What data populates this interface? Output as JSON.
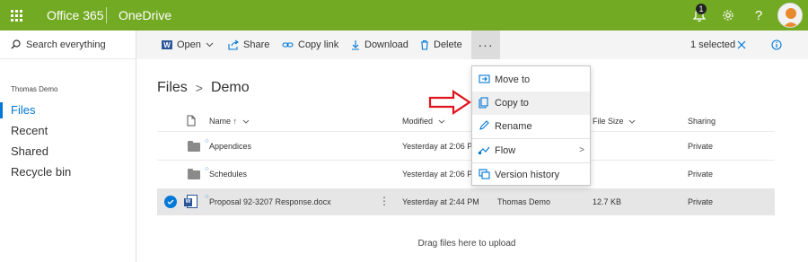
{
  "topbar": {
    "brand": "Office 365",
    "app_name": "OneDrive",
    "notification_count": "1",
    "help_label": "?",
    "accent_color": "#73aa23"
  },
  "sidebar": {
    "search_label": "Search everything",
    "user_name": "Thomas Demo",
    "items": [
      {
        "label": "Files",
        "active": true
      },
      {
        "label": "Recent",
        "active": false
      },
      {
        "label": "Shared",
        "active": false
      },
      {
        "label": "Recycle bin",
        "active": false
      }
    ]
  },
  "commandbar": {
    "open_label": "Open",
    "share_label": "Share",
    "copylink_label": "Copy link",
    "download_label": "Download",
    "delete_label": "Delete",
    "more_label": "···",
    "selected_label": "1 selected"
  },
  "breadcrumb": {
    "root": "Files",
    "separator": ">",
    "current": "Demo"
  },
  "list": {
    "columns": {
      "name": "Name ↑",
      "modified": "Modified",
      "file_size": "File Size",
      "sharing": "Sharing"
    },
    "rows": [
      {
        "name": "Appendices",
        "modified": "Yesterday at 2:06 PM",
        "modified_by": "",
        "size": "",
        "sharing": "Private",
        "selected": false,
        "type": "folder"
      },
      {
        "name": "Schedules",
        "modified": "Yesterday at 2:06 PM",
        "modified_by": "",
        "size": "",
        "sharing": "Private",
        "selected": false,
        "type": "folder"
      },
      {
        "name": "Proposal 92-3207 Response.docx",
        "modified": "Yesterday at 2:44 PM",
        "modified_by": "Thomas Demo",
        "size": "12.7 KB",
        "sharing": "Private",
        "selected": true,
        "type": "docx"
      }
    ],
    "drag_hint": "Drag files here to upload"
  },
  "context_menu": {
    "items": [
      {
        "label": "Move to",
        "icon": "move-to-icon"
      },
      {
        "label": "Copy to",
        "icon": "copy-to-icon"
      },
      {
        "label": "Rename",
        "icon": "rename-icon"
      },
      {
        "label": "Flow",
        "icon": "flow-icon"
      },
      {
        "label": "Version history",
        "icon": "version-history-icon"
      }
    ],
    "flow_chevron": ">"
  }
}
